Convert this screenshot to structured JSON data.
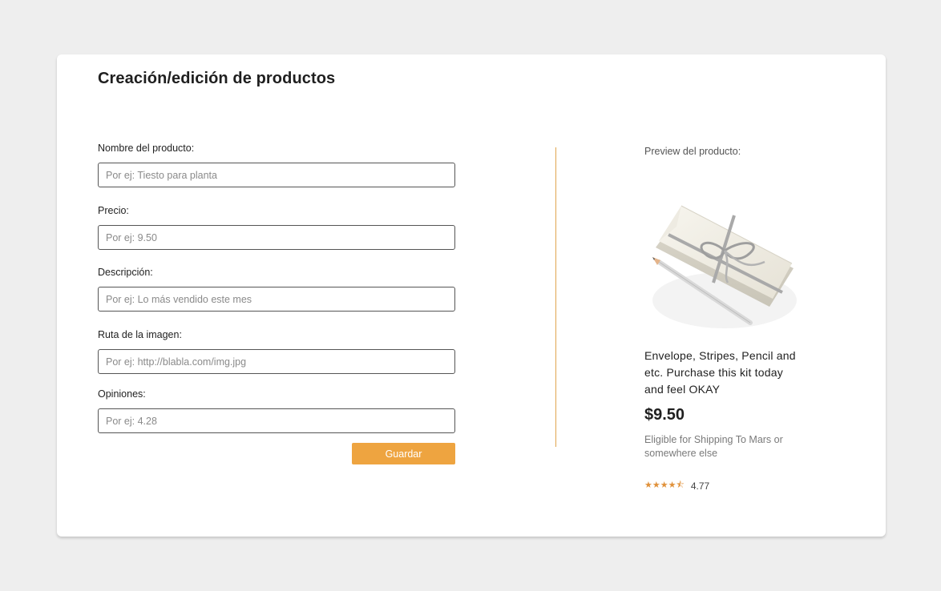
{
  "page": {
    "title": "Creación/edición de productos"
  },
  "form": {
    "fields": [
      {
        "label": "Nombre del producto:",
        "placeholder": "Por ej: Tiesto para planta",
        "value": ""
      },
      {
        "label": "Precio:",
        "placeholder": "Por ej: 9.50",
        "value": ""
      },
      {
        "label": "Descripción:",
        "placeholder": "Por ej: Lo más vendido este mes",
        "value": ""
      },
      {
        "label": "Ruta de la imagen:",
        "placeholder": "Por ej: http://blabla.com/img.jpg",
        "value": ""
      },
      {
        "label": "Opiniones:",
        "placeholder": "Por ej: 4.28",
        "value": ""
      }
    ],
    "save_label": "Guardar"
  },
  "preview": {
    "label": "Preview del producto:",
    "product_name": "Envelope, Stripes, Pencil and etc. Purchase this kit today and feel OKAY",
    "price": "$9.50",
    "shipping": "Eligible for Shipping To Mars or somewhere else",
    "stars": "★★★★⯪",
    "rating": 4.77,
    "image_icon": "envelope-gift-pencil-image"
  },
  "colors": {
    "accent": "#eea440",
    "divider": "#e0a54e",
    "star": "#e0913a",
    "background": "#eeeeee",
    "card": "#ffffff"
  }
}
